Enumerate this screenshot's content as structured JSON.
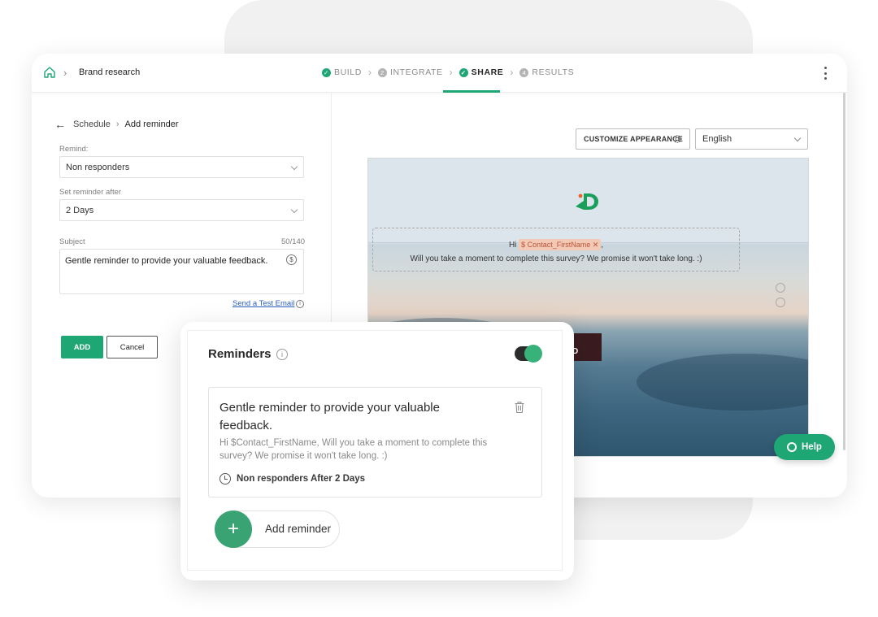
{
  "breadcrumb": {
    "title": "Brand research"
  },
  "steps": [
    {
      "label": "BUILD",
      "state": "done"
    },
    {
      "label": "INTEGRATE",
      "state": "pending",
      "num": "2"
    },
    {
      "label": "SHARE",
      "state": "active"
    },
    {
      "label": "RESULTS",
      "state": "pending",
      "num": "4"
    }
  ],
  "left": {
    "nav_schedule": "Schedule",
    "nav_current": "Add reminder",
    "remind_label": "Remind:",
    "remind_value": "Non responders",
    "after_label": "Set reminder after",
    "after_value": "2 Days",
    "subject_label": "Subject",
    "subject_count": "50/140",
    "subject_value": "Gentle reminder to provide your valuable feedback.",
    "test_link": "Send a Test Email",
    "add_label": "ADD",
    "cancel_label": "Cancel"
  },
  "preview": {
    "customize_label": "CUSTOMIZE APPEARANCE",
    "language": "English",
    "greeting": "Hi",
    "tag": "$ Contact_FirstName",
    "tag_close": "✕",
    "comma": ",",
    "message": "Will you take a moment to complete this survey? We promise it won't take long. :)",
    "start_label": "T STARTED"
  },
  "help_label": "Help",
  "reminders": {
    "title": "Reminders",
    "item_title": "Gentle reminder to provide your valuable feedback.",
    "item_body": "Hi $Contact_FirstName, Will you take a moment to complete this survey? We promise it won't take long. :)",
    "item_meta": "Non responders After 2 Days",
    "add_label": "Add reminder",
    "enabled": true
  },
  "colors": {
    "accent": "#1ea675",
    "tag_bg": "#f3c9b5",
    "start_btn": "#3a1c20"
  }
}
